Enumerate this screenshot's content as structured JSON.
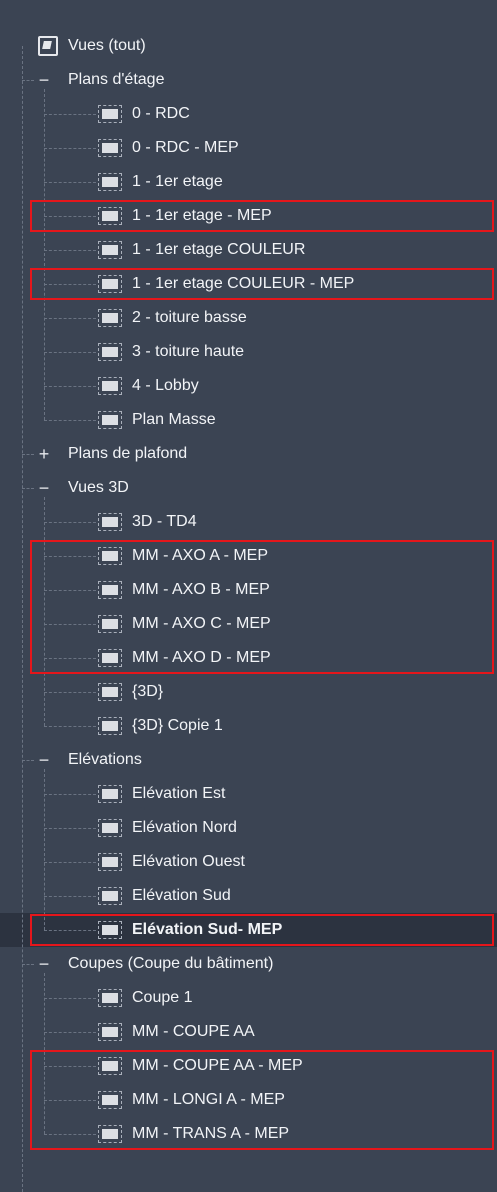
{
  "tree": {
    "root_label": "Vues (tout)",
    "groups": [
      {
        "label": "Plans d'étage",
        "expander": "−",
        "items": [
          {
            "label": "0 - RDC"
          },
          {
            "label": "0 - RDC - MEP"
          },
          {
            "label": "1 - 1er etage"
          },
          {
            "label": "1 - 1er etage - MEP",
            "highlighted": true
          },
          {
            "label": "1 - 1er etage COULEUR"
          },
          {
            "label": "1 - 1er etage COULEUR - MEP",
            "highlighted": true
          },
          {
            "label": "2 - toiture basse"
          },
          {
            "label": "3 - toiture haute"
          },
          {
            "label": "4 - Lobby"
          },
          {
            "label": "Plan Masse"
          }
        ]
      },
      {
        "label": "Plans de plafond",
        "expander": "+",
        "items": []
      },
      {
        "label": "Vues 3D",
        "expander": "−",
        "items": [
          {
            "label": "3D - TD4"
          },
          {
            "label": "MM - AXO A - MEP",
            "highlighted": true
          },
          {
            "label": "MM - AXO B - MEP",
            "highlighted": true
          },
          {
            "label": "MM - AXO C - MEP",
            "highlighted": true
          },
          {
            "label": "MM - AXO D - MEP",
            "highlighted": true
          },
          {
            "label": "{3D}"
          },
          {
            "label": "{3D} Copie 1"
          }
        ]
      },
      {
        "label": "Elévations",
        "expander": "−",
        "items": [
          {
            "label": "Elévation Est"
          },
          {
            "label": "Elévation Nord"
          },
          {
            "label": "Elévation Ouest"
          },
          {
            "label": "Elévation Sud"
          },
          {
            "label": "Elévation Sud- MEP",
            "highlighted": true,
            "selected": true,
            "bold": true
          }
        ]
      },
      {
        "label": "Coupes (Coupe du bâtiment)",
        "expander": "−",
        "items": [
          {
            "label": "Coupe 1"
          },
          {
            "label": "MM - COUPE AA"
          },
          {
            "label": "MM - COUPE AA - MEP",
            "highlighted": true
          },
          {
            "label": "MM - LONGI A - MEP",
            "highlighted": true
          },
          {
            "label": "MM - TRANS A - MEP",
            "highlighted": true
          }
        ]
      }
    ]
  },
  "colors": {
    "panel_background": "#3b4453",
    "selected_row": "#2c3340",
    "highlight_outline": "#e5161b",
    "text": "#f2f4f7"
  },
  "icons": {
    "root": "views-root-icon",
    "item": "view-icon",
    "expanded": "collapse-icon",
    "collapsed": "expand-icon"
  }
}
